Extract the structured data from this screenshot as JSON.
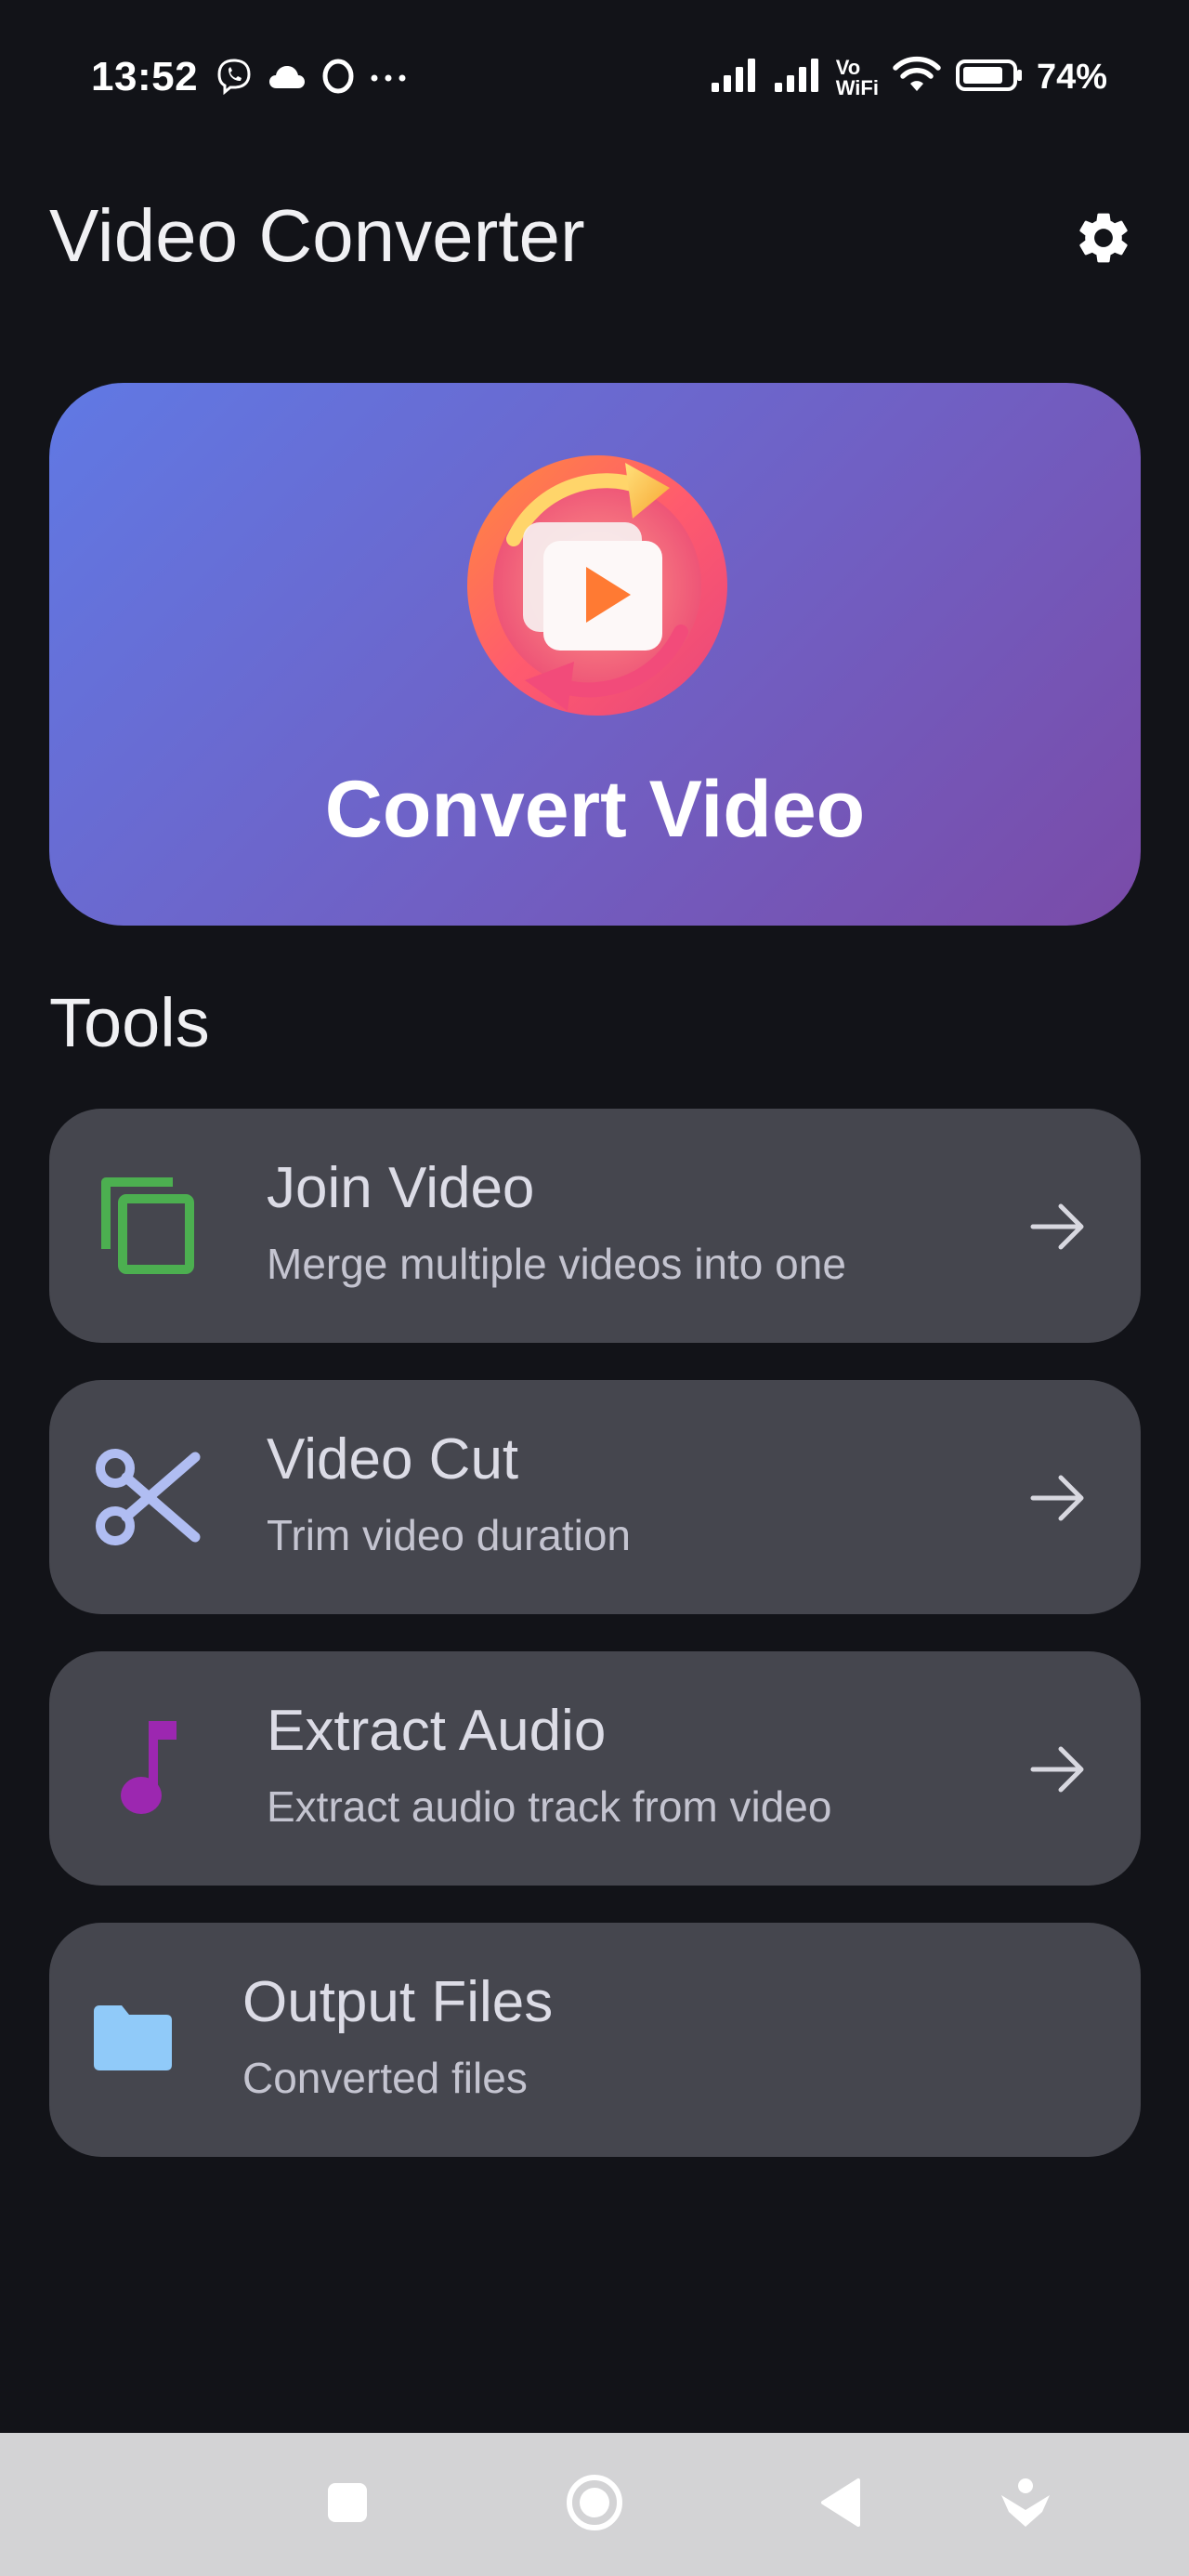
{
  "status_bar": {
    "time": "13:52",
    "battery": "74%",
    "left_icons": [
      "viber-icon",
      "cloud-icon",
      "opera-icon",
      "more-dots-icon"
    ],
    "right_icons": [
      "signal-icon",
      "signal-icon",
      "vowifi-icon",
      "wifi-icon",
      "battery-icon"
    ],
    "vowifi_label_top": "Vo",
    "vowifi_label_bottom": "WiFi"
  },
  "app_bar": {
    "title": "Video Converter",
    "settings_icon": "gear-icon"
  },
  "hero": {
    "label": "Convert Video",
    "icon": "convert-video-icon"
  },
  "tools": {
    "section_title": "Tools",
    "items": [
      {
        "title": "Join Video",
        "subtitle": "Merge multiple videos into one",
        "icon": "copy-icon",
        "icon_color": "#4caf50",
        "has_arrow": true
      },
      {
        "title": "Video Cut",
        "subtitle": "Trim video duration",
        "icon": "scissors-icon",
        "icon_color": "#b0bdf2",
        "has_arrow": true
      },
      {
        "title": "Extract Audio",
        "subtitle": "Extract audio track from video",
        "icon": "music-note-icon",
        "icon_color": "#9c27b0",
        "has_arrow": true
      },
      {
        "title": "Output Files",
        "subtitle": "Converted files",
        "icon": "folder-icon",
        "icon_color": "#90caf9",
        "has_arrow": false
      }
    ]
  },
  "nav_bar": {
    "buttons": [
      "recents-square-icon",
      "home-circle-icon",
      "back-triangle-icon",
      "accessibility-icon"
    ]
  },
  "colors": {
    "background": "#121318",
    "card": "#45464e",
    "hero_gradient_start": "#6079e4",
    "hero_gradient_end": "#7a4ba8",
    "nav_bar": "#d3d3d5"
  }
}
